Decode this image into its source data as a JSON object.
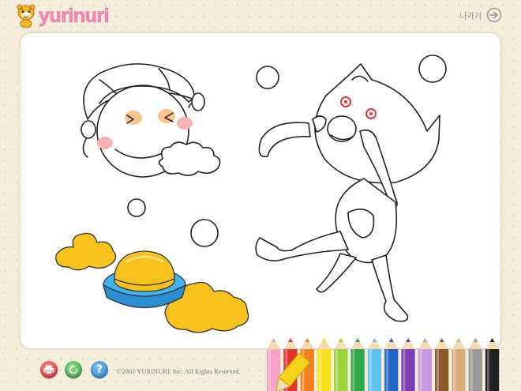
{
  "header": {
    "logo_text": "yurinuri",
    "exit_label": "나가기"
  },
  "footer": {
    "copyright": "©2002 YURINURI, Inc. All Rights Reserved."
  },
  "icons": {
    "print": "print-icon",
    "reset": "reset-icon",
    "help": "help-icon",
    "exit": "arrow-right-circle-icon",
    "logo": "tiger-mascot-icon"
  },
  "colors": {
    "background": "#f4eedb",
    "logo_pink": "#f18ab6",
    "fill_yellow": "#f7c21b",
    "bowl_blue": "#3fb4f0",
    "cheek_pink": "#f7b3b3"
  },
  "palette": {
    "pencils": [
      {
        "name": "pink",
        "color": "#f3a3c4"
      },
      {
        "name": "red",
        "color": "#e4322f"
      },
      {
        "name": "orange",
        "color": "#f5801f"
      },
      {
        "name": "yellow",
        "color": "#f6e21a"
      },
      {
        "name": "light-green",
        "color": "#9ad33c"
      },
      {
        "name": "green",
        "color": "#2ea84a"
      },
      {
        "name": "sky-blue",
        "color": "#5fc4ee"
      },
      {
        "name": "blue",
        "color": "#2365c7"
      },
      {
        "name": "purple",
        "color": "#7a3fb3"
      },
      {
        "name": "light-purple",
        "color": "#c799de"
      },
      {
        "name": "brown",
        "color": "#8b5a2b"
      },
      {
        "name": "tan",
        "color": "#d8ad7a"
      },
      {
        "name": "gray",
        "color": "#9a9a9a"
      },
      {
        "name": "black",
        "color": "#202020"
      }
    ],
    "selected": "yellow"
  }
}
